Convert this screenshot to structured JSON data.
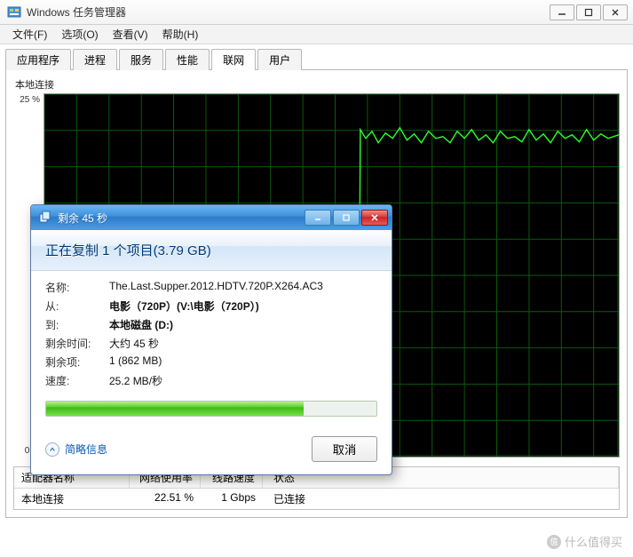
{
  "window": {
    "title": "Windows 任务管理器",
    "menus": [
      "文件(F)",
      "选项(O)",
      "查看(V)",
      "帮助(H)"
    ]
  },
  "tabs": [
    "应用程序",
    "进程",
    "服务",
    "性能",
    "联网",
    "用户"
  ],
  "active_tab_index": 4,
  "graph": {
    "connection_label": "本地连接",
    "y_max_label": "25 %",
    "y_min_label": "0 %"
  },
  "chart_data": {
    "type": "line",
    "title": "本地连接",
    "ylabel": "%",
    "ylim": [
      0,
      100
    ],
    "y_gridlines_visible_top": 25,
    "note": "Time series of network utilization percentage; roughly 0% for first ~55% of timespan then jumps to ~22–23% and holds with small fluctuations",
    "x": [
      0,
      50,
      55,
      56,
      60,
      70,
      80,
      90,
      100
    ],
    "values": [
      0,
      0,
      0,
      22,
      23,
      22.5,
      22,
      22.8,
      22.5
    ]
  },
  "adapter_table": {
    "headers": [
      "适配器名称",
      "网络使用率",
      "线路速度",
      "状态"
    ],
    "rows": [
      {
        "name": "本地连接",
        "util": "22.51 %",
        "speed": "1 Gbps",
        "state": "已连接"
      }
    ]
  },
  "dialog": {
    "title": "剩余 45 秒",
    "header": "正在复制 1 个项目(3.79 GB)",
    "fields": {
      "name_k": "名称:",
      "name_v": "The.Last.Supper.2012.HDTV.720P.X264.AC3",
      "from_k": "从:",
      "from_v": "电影（720P）(V:\\电影（720P）)",
      "to_k": "到:",
      "to_v": "本地磁盘 (D:)",
      "remain_k": "剩余时间:",
      "remain_v": "大约 45 秒",
      "items_k": "剩余项:",
      "items_v": "1 (862 MB)",
      "speed_k": "速度:",
      "speed_v": "25.2 MB/秒"
    },
    "progress_percent": 78,
    "brief_info": "简略信息",
    "cancel": "取消"
  },
  "watermark": "什么值得买"
}
